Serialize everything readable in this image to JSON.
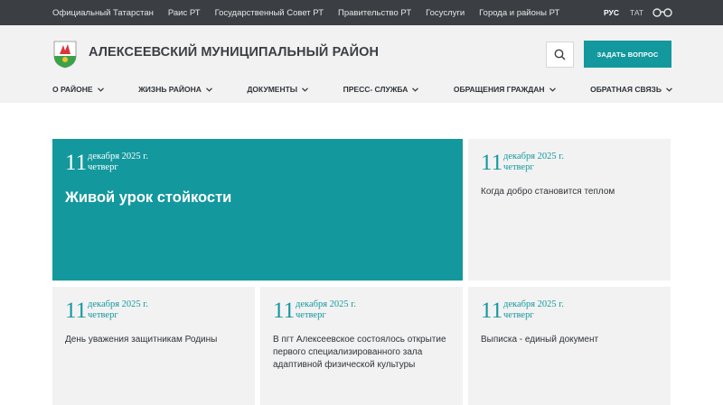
{
  "topbar": {
    "links": [
      "Официальный Татарстан",
      "Раис РТ",
      "Государственный Совет РТ",
      "Правительство РТ",
      "Госуслуги",
      "Города и районы РТ"
    ],
    "lang_active": "РУС",
    "lang_other": "ТАТ"
  },
  "header": {
    "title": "АЛЕКСЕЕВСКИЙ МУНИЦИПАЛЬНЫЙ РАЙОН",
    "ask_button": "ЗАДАТЬ ВОПРОС"
  },
  "nav": [
    "О РАЙОНЕ",
    "ЖИЗНЬ РАЙОНА",
    "ДОКУМЕНТЫ",
    "ПРЕСС- СЛУЖБА",
    "ОБРАЩЕНИЯ ГРАЖДАН",
    "ОБРАТНАЯ СВЯЗЬ"
  ],
  "news": [
    {
      "day": "11",
      "month_year": "декабря 2025 г.",
      "weekday": "четверг",
      "title": "Живой урок стойкости"
    },
    {
      "day": "11",
      "month_year": "декабря 2025 г.",
      "weekday": "четверг",
      "title": "Когда добро становится теплом"
    },
    {
      "day": "11",
      "month_year": "декабря 2025 г.",
      "weekday": "четверг",
      "title": "День уважения защитникам Родины"
    },
    {
      "day": "11",
      "month_year": "декабря 2025 г.",
      "weekday": "четверг",
      "title": "В пгт Алексеевское состоялось открытие первого специализированного зала адаптивной физической культуры"
    },
    {
      "day": "11",
      "month_year": "декабря 2025 г.",
      "weekday": "четверг",
      "title": "Выписка - единый документ"
    }
  ],
  "colors": {
    "accent": "#13989e",
    "topbar": "#3b3f44",
    "header_bg": "#f2f2f2"
  }
}
